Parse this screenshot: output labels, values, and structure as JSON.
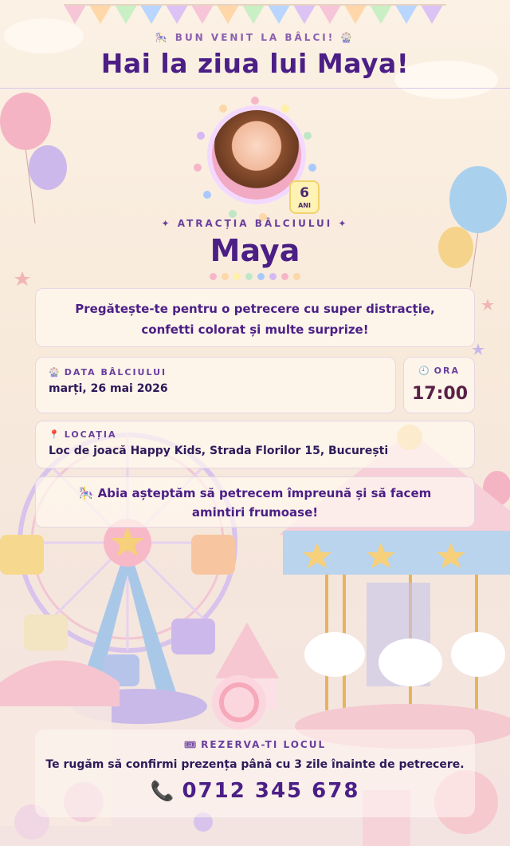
{
  "header": {
    "kicker": "🎠 BUN VENIT LA BÂLCI! 🎡",
    "title": "Hai la ziua lui Maya!"
  },
  "profile": {
    "age_number": "6",
    "age_unit": "ANI",
    "attraction_label": "✦ ATRACȚIA BÂLCIULUI ✦",
    "name": "Maya"
  },
  "intro": {
    "text": "Pregătește-te pentru o petrecere cu super distracție, confetti colorat și multe surprize!"
  },
  "date": {
    "icon": "ferris-wheel-icon",
    "icon_glyph": "🎡",
    "label": "DATA BÂLCIULUI",
    "value": "marți, 26 mai 2026"
  },
  "time": {
    "icon": "clock-icon",
    "icon_glyph": "🕘",
    "label": "ORA",
    "value": "17:00"
  },
  "location": {
    "icon": "pin-icon",
    "icon_glyph": "📍",
    "label": "LOCAȚIA",
    "value": "Loc de joacă Happy Kids, Strada Florilor 15, București"
  },
  "message": {
    "text": "🎠 Abia așteptăm să petrecem împreună și să facem amintiri frumoase!"
  },
  "rsvp": {
    "icon": "ticket-icon",
    "icon_glyph": "🎟",
    "label": "REZERVA-TI LOCUL",
    "text": "Te rugăm să confirmi prezența până cu 3 zile înainte de petrecere.",
    "phone_icon": "phone-icon",
    "phone_glyph": "📞",
    "phone": "0712 345 678"
  },
  "colors": {
    "primary": "#4b1f86",
    "accent": "#6a3f9d",
    "background": "#fbf1e4",
    "dots": [
      "#f7b6c8",
      "#fcd7a8",
      "#fff0a8",
      "#bfe7c7",
      "#a9c8ff",
      "#d7b8f3",
      "#f7b6c8",
      "#fcd7a8"
    ]
  }
}
